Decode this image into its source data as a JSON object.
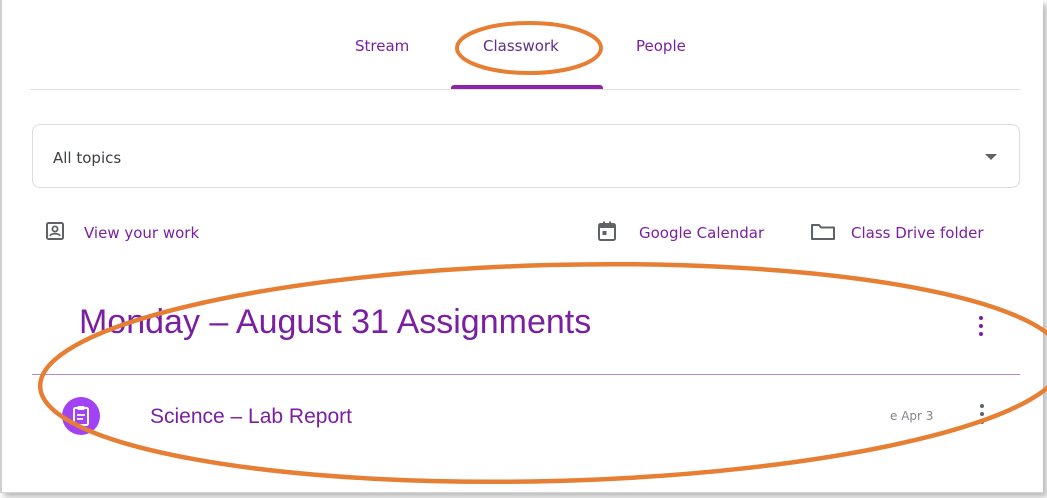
{
  "tabs": [
    {
      "label": "Stream"
    },
    {
      "label": "Classwork"
    },
    {
      "label": "People"
    }
  ],
  "active_tab": "Classwork",
  "filter": {
    "selected": "All topics"
  },
  "links": {
    "view_work": "View your work",
    "calendar": "Google Calendar",
    "drive": "Class Drive folder"
  },
  "section": {
    "title": "Monday – August 31 Assignments",
    "items": [
      {
        "title": "Science – Lab Report",
        "due": "e Apr 3"
      }
    ]
  },
  "colors": {
    "accent": "#7b1fa2",
    "annotation": "#e67e33",
    "avatar": "#a142f4"
  }
}
